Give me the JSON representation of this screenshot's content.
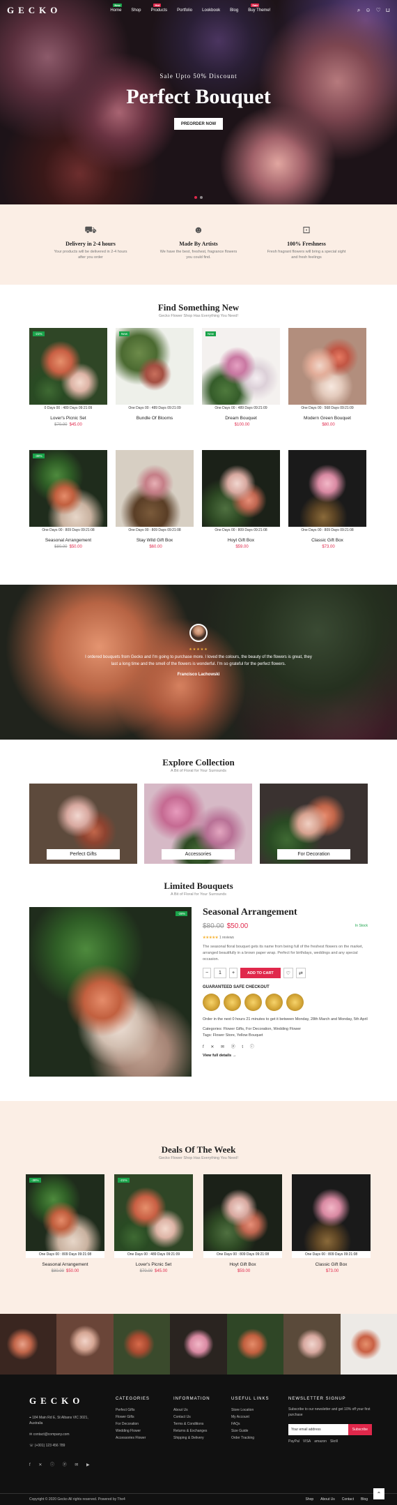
{
  "header": {
    "logo": "GECKO",
    "nav": [
      {
        "label": "Home",
        "badge": "New"
      },
      {
        "label": "Shop",
        "badge": ""
      },
      {
        "label": "Products",
        "badge": "Hot"
      },
      {
        "label": "Portfolio",
        "badge": ""
      },
      {
        "label": "Lookbook",
        "badge": ""
      },
      {
        "label": "Blog",
        "badge": ""
      },
      {
        "label": "Buy Theme!",
        "badge": "Sale"
      }
    ]
  },
  "hero": {
    "subtitle": "Sale Upto 50% Discount",
    "title": "Perfect Bouquet",
    "button": "PREORDER NOW"
  },
  "features": [
    {
      "title": "Delivery in 2-4 hours",
      "desc": "Your products will be delivered in 2-4 hours after you order"
    },
    {
      "title": "Made By Artists",
      "desc": "We have the best, freshest, fragrance flowers you could find."
    },
    {
      "title": "100% Freshness",
      "desc": "Fresh fragrant flowers will bring a special sight and fresh feelings"
    }
  ],
  "find": {
    "title": "Find Something New",
    "subtitle": "Gecko Flower Shop Has Everything You Need!"
  },
  "products": [
    {
      "countdown": "0 Days 00 : 489 Days 09:21:09",
      "name": "Lover's Picnic Set",
      "old": "$70.00",
      "new": "$45.00",
      "badge": "-21%"
    },
    {
      "countdown": "One Days 00 : 489 Days 09:21:09",
      "name": "Bundle Of Blooms",
      "old": "",
      "new": "",
      "badge": "New"
    },
    {
      "countdown": "One Days 00 : 489 Days 09:21:09",
      "name": "Dream Bouquet",
      "old": "",
      "new": "$100.00",
      "badge": "New"
    },
    {
      "countdown": "One Days 00 : 568 Days 09:21:09",
      "name": "Modern Green Bouquet",
      "old": "",
      "new": "$80.00",
      "badge": ""
    },
    {
      "countdown": "One Days 00 : 809 Days 09:21:08",
      "name": "Seasonal Arrangement",
      "old": "$80.00",
      "new": "$50.00",
      "badge": "-38%"
    },
    {
      "countdown": "One Days 00 : 809 Days 09:21:08",
      "name": "Stay Wild Gift Box",
      "old": "",
      "new": "$60.00",
      "badge": ""
    },
    {
      "countdown": "One Days 00 : 809 Days 09:21:08",
      "name": "Hoyt Gift Box",
      "old": "",
      "new": "$59.00",
      "badge": ""
    },
    {
      "countdown": "One Days 00 : 809 Days 09:21:08",
      "name": "Classic Gift Box",
      "old": "",
      "new": "$73.00",
      "badge": ""
    }
  ],
  "testimonial": {
    "stars": "★★★★★",
    "quote": "I ordered bouquets from Gecko and I'm going to purchase more. I loved the colours, the beauty of the flowers is great, they last a long time and the smell of the flowers is wonderful. I'm so grateful for the perfect flowers.",
    "name": "Francisco Lachowski"
  },
  "collection": {
    "title": "Explore Collection",
    "subtitle": "A Bit of Floral for Your Surrounds",
    "items": [
      "Perfect Gifts",
      "Accessories",
      "For Decoration"
    ]
  },
  "limited": {
    "title": "Limited Bouquets",
    "subtitle": "A Bit of Floral for Your Surrounds",
    "badge": "-38%",
    "name": "Seasonal Arrangement",
    "old": "$80.00",
    "new": "$50.00",
    "stock": "In Stock",
    "rating": "★★★★★",
    "reviews": "1 reviews",
    "desc": "The seasonal floral bouquet gets its name from being full of the freshest flowers on the market, arranged beautifully in a brown paper wrap. Perfect for birthdays, weddings and any special occasion.",
    "qty": "1",
    "add": "ADD TO CART",
    "safe": "GUARANTEED SAFE CHECKOUT",
    "info1": "Order in the next 0 hours 21 minutes to get it between Monday, 28th March and Monday, 5th April",
    "info2": "Categories: Flower Gifts, For Decoration, Wedding Flower",
    "info3": "Tags: Flower Store, Yellow Bouquet",
    "more": "View full details →"
  },
  "deals": {
    "title": "Deals Of The Week",
    "subtitle": "Gecko Flower Shop Has Everything You Need!",
    "items": [
      {
        "countdown": "One Days 00 : 809 Days 09:21:08",
        "name": "Seasonal Arrangement",
        "old": "$80.00",
        "new": "$50.00",
        "badge": "-38%"
      },
      {
        "countdown": "One Days 00 : 489 Days 09:21:09",
        "name": "Lover's Picnic Set",
        "old": "$70.00",
        "new": "$45.00",
        "badge": "-21%"
      },
      {
        "countdown": "One Days 00 : 809 Days 09:21:08",
        "name": "Hoyt Gift Box",
        "old": "",
        "new": "$59.00",
        "badge": ""
      },
      {
        "countdown": "One Days 00 : 809 Days 09:21:08",
        "name": "Classic Gift Box",
        "old": "",
        "new": "$73.00",
        "badge": ""
      }
    ]
  },
  "footer": {
    "logo": "GECKO",
    "address": "184 Main Rd E, St Albans VIC 3021, Australia",
    "email": "contact@company.com",
    "phone": "(+001) 123 456 789",
    "cols": [
      {
        "head": "CATEGORIES",
        "links": [
          "Perfect Gifts",
          "Flower Gifts",
          "For Decoration",
          "Wedding Flower",
          "Accessories Flower"
        ]
      },
      {
        "head": "INFORMATION",
        "links": [
          "About Us",
          "Contact Us",
          "Terms & Conditions",
          "Returns & Exchanges",
          "Shipping & Delivery"
        ]
      },
      {
        "head": "USEFUL LINKS",
        "links": [
          "Store Location",
          "My Account",
          "FAQs",
          "Size Guide",
          "Order Tracking"
        ]
      }
    ],
    "newsletter": {
      "head": "NEWSLETTER SIGNUP",
      "desc": "Subscribe to our newsletter and get 10% off your first purchase",
      "placeholder": "Your email address",
      "button": "Subscribe",
      "pay": [
        "PayPal",
        "VISA",
        "amazon",
        "Skrill"
      ]
    },
    "copyright": "Copyright © 2020 Gecko All rights reserved. Powered by The4",
    "links": [
      "Shop",
      "About Us",
      "Contact",
      "Blog"
    ]
  }
}
